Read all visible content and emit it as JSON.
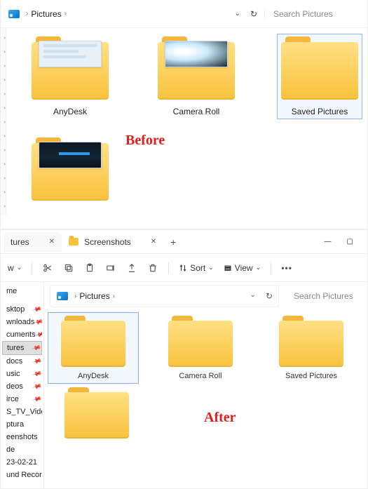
{
  "before_label": "Before",
  "after_label": "After",
  "win1": {
    "breadcrumb_location": "Pictures",
    "search_placeholder": "Search Pictures",
    "folders": [
      {
        "label": "AnyDesk",
        "has_preview": true,
        "preview_kind": "light"
      },
      {
        "label": "Camera Roll",
        "has_preview": true,
        "preview_kind": "cam"
      },
      {
        "label": "Saved Pictures",
        "has_preview": false,
        "selected": true
      },
      {
        "label": "",
        "has_preview": true,
        "preview_kind": "dark"
      }
    ]
  },
  "win2": {
    "tabs": [
      {
        "label": "tures",
        "active": true
      },
      {
        "label": "Screenshots",
        "active": false
      }
    ],
    "toolbar_new_trunc": "w",
    "toolbar_sort": "Sort",
    "toolbar_view": "View",
    "breadcrumb_location": "Pictures",
    "search_placeholder": "Search Pictures",
    "sidebar": [
      {
        "label": "me",
        "pin": false,
        "active": false
      },
      {
        "label": "sktop",
        "pin": true,
        "active": false
      },
      {
        "label": "wnloads",
        "pin": true,
        "active": false
      },
      {
        "label": "cuments",
        "pin": true,
        "active": false
      },
      {
        "label": "tures",
        "pin": true,
        "active": true
      },
      {
        "label": "docs",
        "pin": true,
        "active": false
      },
      {
        "label": "usic",
        "pin": true,
        "active": false
      },
      {
        "label": "deos",
        "pin": true,
        "active": false
      },
      {
        "label": "irce",
        "pin": true,
        "active": false
      },
      {
        "label": "S_TV_Video",
        "pin": true,
        "active": false
      },
      {
        "label": "ptura",
        "pin": false,
        "active": false
      },
      {
        "label": "eenshots",
        "pin": false,
        "active": false
      },
      {
        "label": "de",
        "pin": false,
        "active": false
      },
      {
        "label": "23-02-21",
        "pin": false,
        "active": false
      },
      {
        "label": "und Recording",
        "pin": false,
        "active": false
      }
    ],
    "folders": [
      {
        "label": "AnyDesk",
        "selected": true
      },
      {
        "label": "Camera Roll",
        "selected": false
      },
      {
        "label": "Saved Pictures",
        "selected": false
      },
      {
        "label": "",
        "selected": false
      }
    ]
  }
}
